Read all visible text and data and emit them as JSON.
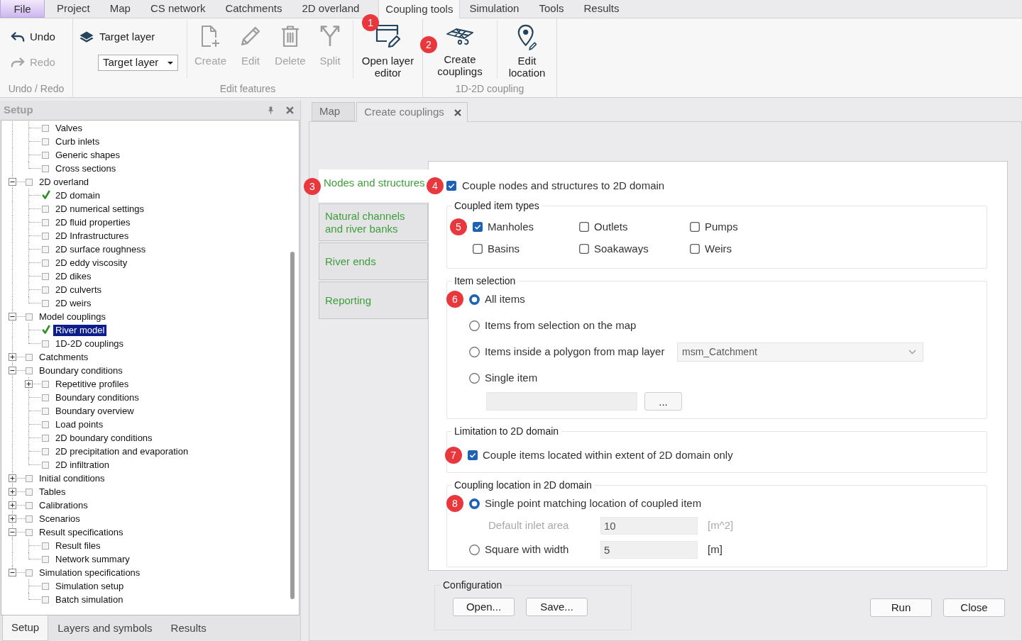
{
  "ribbon": {
    "tabs": [
      {
        "label": "File",
        "kind": "file",
        "selected": false
      },
      {
        "label": "Project",
        "kind": "tab",
        "selected": false
      },
      {
        "label": "Map",
        "kind": "tab",
        "selected": false
      },
      {
        "label": "CS network",
        "kind": "tab",
        "selected": false
      },
      {
        "label": "Catchments",
        "kind": "tab",
        "selected": false
      },
      {
        "label": "2D overland",
        "kind": "tab",
        "selected": false
      },
      {
        "label": "Coupling tools",
        "kind": "tab",
        "selected": true
      },
      {
        "label": "Simulation",
        "kind": "tab",
        "selected": false
      },
      {
        "label": "Tools",
        "kind": "tab",
        "selected": false
      },
      {
        "label": "Results",
        "kind": "tab",
        "selected": false
      }
    ],
    "groups": [
      {
        "label": "Undo / Redo",
        "sections": [
          [
            {
              "kind": "small",
              "label": "Undo",
              "disabled": false
            },
            {
              "kind": "small",
              "label": "Redo",
              "disabled": true
            }
          ]
        ]
      },
      {
        "label": "Edit features",
        "sections": [
          [
            {
              "kind": "layer_picker",
              "label": "Target layer",
              "value": "Target layer"
            }
          ],
          [
            {
              "kind": "large",
              "label": "Create",
              "disabled": true
            },
            {
              "kind": "large",
              "label": "Edit",
              "disabled": true
            },
            {
              "kind": "large",
              "label": "Delete",
              "disabled": true
            },
            {
              "kind": "large",
              "label": "Split",
              "disabled": true
            }
          ],
          [
            {
              "kind": "large",
              "label": "Open layer editor",
              "disabled": false,
              "callout": "1"
            }
          ]
        ]
      },
      {
        "label": "1D-2D coupling",
        "sections": [
          [
            {
              "kind": "large",
              "label": "Create couplings",
              "disabled": false,
              "callout": "2"
            }
          ],
          [
            {
              "kind": "large",
              "label": "Edit location",
              "disabled": false
            }
          ]
        ]
      }
    ]
  },
  "setup_panel": {
    "title": "Setup",
    "tree": {
      "continued_children": [
        {
          "label": "Valves",
          "checked": false,
          "selected": false
        },
        {
          "label": "Curb inlets",
          "checked": false,
          "selected": false
        },
        {
          "label": "Generic shapes",
          "checked": false,
          "selected": false
        },
        {
          "label": "Cross sections",
          "checked": false,
          "selected": false
        }
      ],
      "items": [
        {
          "label": "2D overland",
          "checked": false,
          "selected": false,
          "expanded": true,
          "children": [
            {
              "label": "2D domain",
              "checked": true,
              "selected": false
            },
            {
              "label": "2D numerical settings",
              "checked": false,
              "selected": false
            },
            {
              "label": "2D fluid properties",
              "checked": false,
              "selected": false
            },
            {
              "label": "2D Infrastructures",
              "checked": false,
              "selected": false
            },
            {
              "label": "2D surface roughness",
              "checked": false,
              "selected": false
            },
            {
              "label": "2D eddy viscosity",
              "checked": false,
              "selected": false
            },
            {
              "label": "2D dikes",
              "checked": false,
              "selected": false
            },
            {
              "label": "2D culverts",
              "checked": false,
              "selected": false
            },
            {
              "label": "2D weirs",
              "checked": false,
              "selected": false
            }
          ]
        },
        {
          "label": "Model couplings",
          "checked": false,
          "selected": false,
          "expanded": true,
          "children": [
            {
              "label": "River model",
              "checked": true,
              "selected": true
            },
            {
              "label": "1D-2D couplings",
              "checked": false,
              "selected": false
            }
          ]
        },
        {
          "label": "Catchments",
          "checked": false,
          "selected": false,
          "expanded": false
        },
        {
          "label": "Boundary conditions",
          "checked": false,
          "selected": false,
          "expanded": true,
          "children": [
            {
              "label": "Repetitive profiles",
              "checked": false,
              "selected": false,
              "expanded": false
            },
            {
              "label": "Boundary conditions",
              "checked": false,
              "selected": false
            },
            {
              "label": "Boundary overview",
              "checked": false,
              "selected": false
            },
            {
              "label": "Load points",
              "checked": false,
              "selected": false
            },
            {
              "label": "2D boundary conditions",
              "checked": false,
              "selected": false
            },
            {
              "label": "2D precipitation and evaporation",
              "checked": false,
              "selected": false
            },
            {
              "label": "2D infiltration",
              "checked": false,
              "selected": false
            }
          ]
        },
        {
          "label": "Initial conditions",
          "checked": false,
          "selected": false,
          "expanded": false
        },
        {
          "label": "Tables",
          "checked": false,
          "selected": false,
          "expanded": false
        },
        {
          "label": "Calibrations",
          "checked": false,
          "selected": false,
          "expanded": false
        },
        {
          "label": "Scenarios",
          "checked": false,
          "selected": false,
          "expanded": false
        },
        {
          "label": "Result specifications",
          "checked": false,
          "selected": false,
          "expanded": true,
          "children": [
            {
              "label": "Result files",
              "checked": false,
              "selected": false
            },
            {
              "label": "Network summary",
              "checked": false,
              "selected": false
            }
          ]
        },
        {
          "label": "Simulation specifications",
          "checked": false,
          "selected": false,
          "expanded": true,
          "children": [
            {
              "label": "Simulation setup",
              "checked": false,
              "selected": false
            },
            {
              "label": "Batch simulation",
              "checked": false,
              "selected": false
            }
          ]
        }
      ]
    },
    "tabs": [
      {
        "label": "Setup",
        "selected": true
      },
      {
        "label": "Layers and symbols",
        "selected": false
      },
      {
        "label": "Results",
        "selected": false
      }
    ]
  },
  "document_tabs": [
    {
      "label": "Map",
      "selected": false,
      "closable": false
    },
    {
      "label": "Create couplings",
      "selected": true,
      "closable": true
    }
  ],
  "coupling_editor": {
    "side_tabs": [
      {
        "label": "Nodes and structures",
        "selected": true,
        "callout": "3"
      },
      {
        "label": "Natural channels and river banks",
        "selected": false
      },
      {
        "label": "River ends",
        "selected": false
      },
      {
        "label": "Reporting",
        "selected": false
      }
    ],
    "enable": {
      "label": "Couple nodes and structures to 2D domain",
      "checked": true,
      "callout": "4"
    },
    "groups": [
      {
        "kind": "checkbox_grid",
        "title": "Coupled item types",
        "items": [
          {
            "label": "Manholes",
            "checked": true,
            "callout": "5"
          },
          {
            "label": "Outlets",
            "checked": false
          },
          {
            "label": "Pumps",
            "checked": false
          },
          {
            "label": "Basins",
            "checked": false
          },
          {
            "label": "Soakaways",
            "checked": false
          },
          {
            "label": "Weirs",
            "checked": false
          }
        ]
      },
      {
        "kind": "options",
        "title": "Item selection",
        "rows": [
          {
            "kind": "radio",
            "label": "All items",
            "selected": true,
            "callout": "6"
          },
          {
            "kind": "radio",
            "label": "Items from selection on the map",
            "selected": false
          },
          {
            "kind": "radio",
            "label": "Items inside a polygon from map layer",
            "selected": false,
            "dropdown": {
              "value": "msm_Catchment",
              "disabled": true
            }
          },
          {
            "kind": "radio",
            "label": "Single item",
            "selected": false
          },
          {
            "kind": "picker",
            "disabled": true,
            "button": "..."
          }
        ]
      },
      {
        "kind": "checkbox_list",
        "title": "Limitation to 2D domain",
        "items": [
          {
            "label": "Couple items located within extent of 2D domain only",
            "checked": true,
            "callout": "7"
          }
        ]
      },
      {
        "kind": "options",
        "title": "Coupling location in 2D domain",
        "rows": [
          {
            "kind": "radio",
            "label": "Single point matching location of coupled item",
            "selected": true,
            "callout": "8"
          },
          {
            "kind": "param",
            "label": "Default inlet area",
            "value": "10",
            "unit": "[m^2]",
            "disabled": true
          },
          {
            "kind": "radio",
            "label": "Square with width",
            "selected": false,
            "value": "5",
            "unit": "[m]"
          }
        ]
      }
    ],
    "configuration": {
      "title": "Configuration",
      "buttons": [
        "Open...",
        "Save..."
      ]
    },
    "actions": [
      "Run",
      "Close"
    ]
  }
}
